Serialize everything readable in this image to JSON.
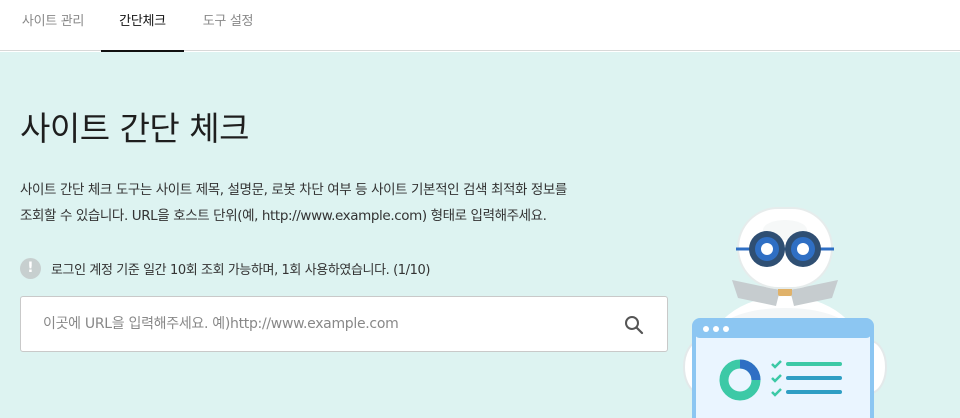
{
  "tabs": [
    {
      "label": "사이트 관리",
      "active": false
    },
    {
      "label": "간단체크",
      "active": true
    },
    {
      "label": "도구 설정",
      "active": false
    }
  ],
  "page": {
    "title": "사이트 간단 체크",
    "description_line1": "사이트 간단 체크 도구는 사이트 제목, 설명문, 로봇 차단 여부 등 사이트 기본적인 검색 최적화 정보를",
    "description_line2": "조회할 수 있습니다. URL을 호스트 단위(예, http://www.example.com) 형태로 입력해주세요."
  },
  "notice": {
    "icon": "exclamation-icon",
    "text": "로그인 계정 기준 일간 10회 조회 가능하며, 1회 사용하였습니다. (1/10)"
  },
  "search": {
    "placeholder": "이곳에 URL을 입력해주세요. 예)http://www.example.com",
    "value": "",
    "icon": "search-icon"
  },
  "colors": {
    "hero_background": "#ddf3f1",
    "active_tab": "#111111",
    "inactive_tab": "#888888",
    "robot_eye": "#2f6fc4",
    "chart_green": "#3cc9a6",
    "browser_blue": "#8cc6f2"
  }
}
